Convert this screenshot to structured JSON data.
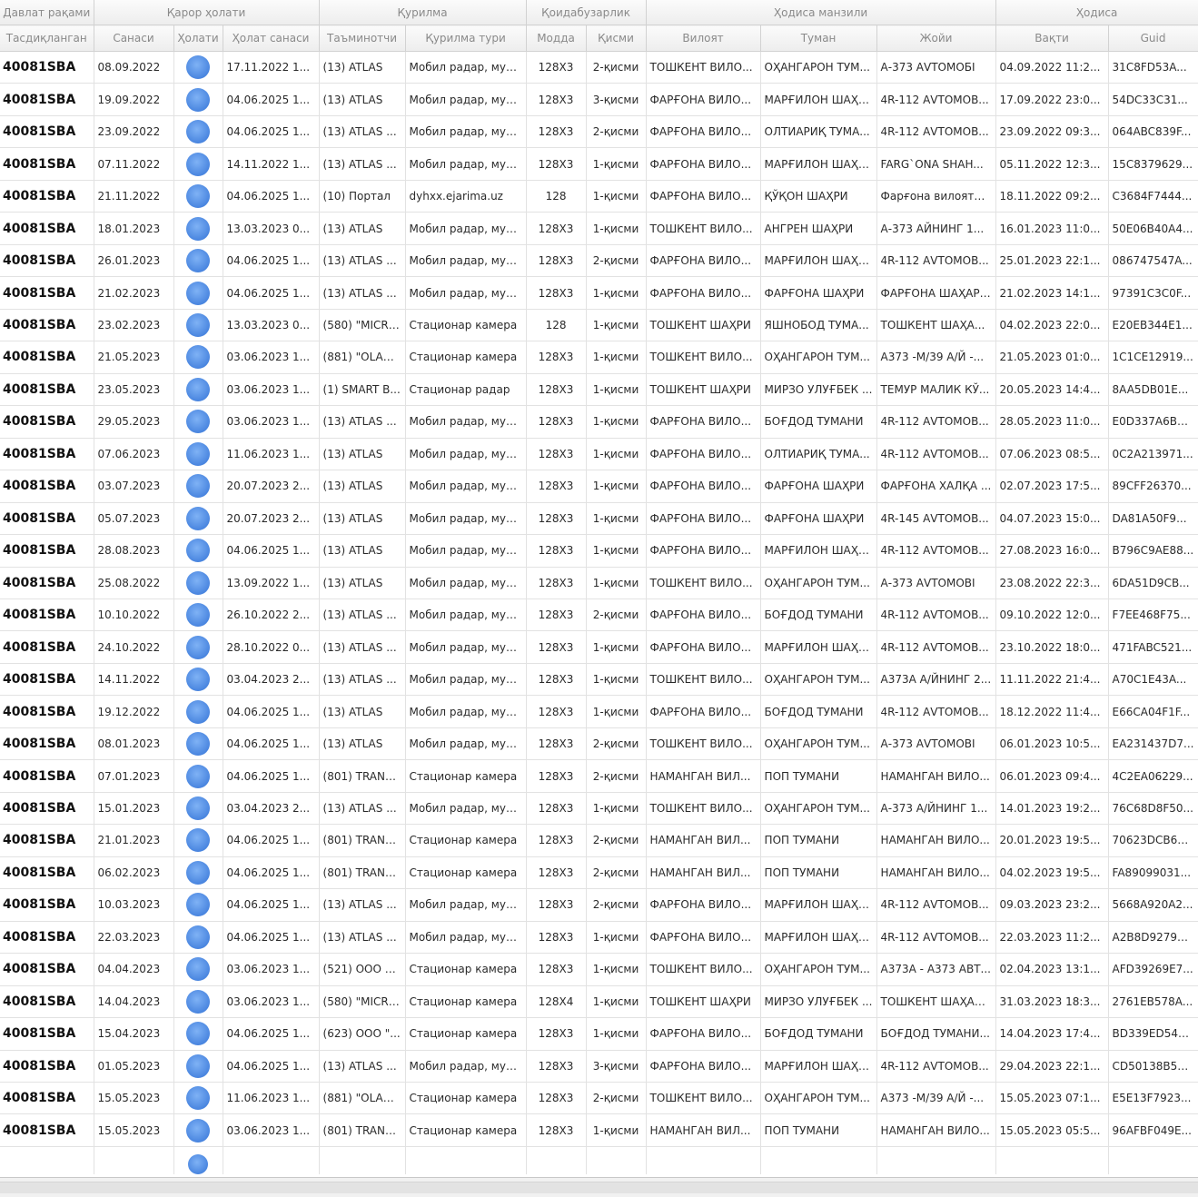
{
  "grid": {
    "band_headers": [
      {
        "label": "Давлат рақами",
        "span": 1
      },
      {
        "label": "Қарор ҳолати",
        "span": 3
      },
      {
        "label": "Қурилма",
        "span": 2
      },
      {
        "label": "Қоидабузарлик",
        "span": 2
      },
      {
        "label": "Ҳодиса манзили",
        "span": 3
      },
      {
        "label": "Ҳодиса",
        "span": 2
      }
    ],
    "columns": [
      "Тасдиқланган",
      "Санаси",
      "Ҳолати",
      "Ҳолат санаси",
      "Таъминотчи",
      "Қурилма тури",
      "Модда",
      "Қисми",
      "Вилоят",
      "Туман",
      "Жойи",
      "Вақти",
      "Guid"
    ],
    "status_icon": "blue-circle-status-icon",
    "accent_color": "#4a86e0",
    "rows": [
      [
        "40081SBA",
        "08.09.2022",
        "",
        "17.11.2022 1...",
        "(13) ATLAS",
        "Мобил радар, мув...",
        "128X3",
        "2-қисми",
        "ТОШКЕНТ ВИЛО...",
        "ОҲАНГАРОН ТУМ...",
        "А-373 АVТОМОБI",
        "04.09.2022 11:2...",
        "31C8FD53A..."
      ],
      [
        "40081SBA",
        "19.09.2022",
        "",
        "04.06.2025 1...",
        "(13) ATLAS",
        "Мобил радар, мув...",
        "128X3",
        "3-қисми",
        "ФАРҒОНА ВИЛО...",
        "МАРҒИЛОН ШАҲРИ",
        "4R-112 АVТОМОВ...",
        "17.09.2022 23:0...",
        "54DC33C31..."
      ],
      [
        "40081SBA",
        "23.09.2022",
        "",
        "04.06.2025 1...",
        "(13) ATLAS ...",
        "Мобил радар, мув...",
        "128X3",
        "2-қисми",
        "ФАРҒОНА ВИЛО...",
        "ОЛТИАРИҚ ТУМА...",
        "4R-112 АVТОМОВ...",
        "23.09.2022 09:3...",
        "064ABC839F..."
      ],
      [
        "40081SBA",
        "07.11.2022",
        "",
        "14.11.2022 1...",
        "(13) ATLAS ...",
        "Мобил радар, мув...",
        "128X3",
        "1-қисми",
        "ФАРҒОНА ВИЛО...",
        "МАРҒИЛОН ШАҲРИ",
        "FARG`ONA SHAH...",
        "05.11.2022 12:3...",
        "15C8379629..."
      ],
      [
        "40081SBA",
        "21.11.2022",
        "",
        "04.06.2025 1...",
        "(10) Портал",
        "dyhxx.ejarima.uz",
        "128",
        "1-қисми",
        "ФАРҒОНА ВИЛО...",
        "ҚЎҚОН ШАҲРИ",
        "Фарғона вилояти ...",
        "18.11.2022 09:2...",
        "C3684F7444..."
      ],
      [
        "40081SBA",
        "18.01.2023",
        "",
        "13.03.2023 0...",
        "(13) ATLAS",
        "Мобил радар, мув...",
        "128X3",
        "1-қисми",
        "ТОШКЕНТ ВИЛО...",
        "АНГРЕН ШАҲРИ",
        "А-373 АЙНИНГ 1...",
        "16.01.2023 11:0...",
        "50E06B40A4..."
      ],
      [
        "40081SBA",
        "26.01.2023",
        "",
        "04.06.2025 1...",
        "(13) ATLAS ...",
        "Мобил радар, мув...",
        "128X3",
        "2-қисми",
        "ФАРҒОНА ВИЛО...",
        "МАРҒИЛОН ШАҲРИ",
        "4R-112 АVТОМОВ...",
        "25.01.2023 22:1...",
        "086747547A..."
      ],
      [
        "40081SBA",
        "21.02.2023",
        "",
        "04.06.2025 1...",
        "(13) ATLAS ...",
        "Мобил радар, мув...",
        "128X3",
        "1-қисми",
        "ФАРҒОНА ВИЛО...",
        "ФАРҒОНА ШАҲРИ",
        "ФАРҒОНА ШАҲАР ...",
        "21.02.2023 14:1...",
        "97391C3C0F..."
      ],
      [
        "40081SBA",
        "23.02.2023",
        "",
        "13.03.2023 0...",
        "(580) \"MICR ...",
        "Стационар камера",
        "128",
        "1-қисми",
        "ТОШКЕНТ ШАҲРИ",
        "ЯШНОБОД ТУМА...",
        "ТОШКЕНТ ШАҲА...",
        "04.02.2023 22:0...",
        "E20EB344E1..."
      ],
      [
        "40081SBA",
        "21.05.2023",
        "",
        "03.06.2023 1...",
        "(881) \"OLAN ...",
        "Стационар камера",
        "128X3",
        "1-қисми",
        "ТОШКЕНТ ВИЛО...",
        "ОҲАНГАРОН ТУМ...",
        "А373 -М/39 А/Й -...",
        "21.05.2023 01:0...",
        "1C1CE12919..."
      ],
      [
        "40081SBA",
        "23.05.2023",
        "",
        "03.06.2023 1...",
        "(1) SMART B...",
        "Стационар радар",
        "128X3",
        "1-қисми",
        "ТОШКЕНТ ШАҲРИ",
        "МИРЗО УЛУҒБЕК ...",
        "ТЕМУР МАЛИК КЎ...",
        "20.05.2023 14:4...",
        "8AA5DB01E..."
      ],
      [
        "40081SBA",
        "29.05.2023",
        "",
        "03.06.2023 1...",
        "(13) ATLAS ...",
        "Мобил радар, мув...",
        "128X3",
        "1-қисми",
        "ФАРҒОНА ВИЛО...",
        "БОҒДОД ТУМАНИ",
        "4R-112 АVТОМОВ...",
        "28.05.2023 11:0...",
        "E0D337A6BE..."
      ],
      [
        "40081SBA",
        "07.06.2023",
        "",
        "11.06.2023 1...",
        "(13) ATLAS",
        "Мобил радар, мув...",
        "128X3",
        "1-қисми",
        "ФАРҒОНА ВИЛО...",
        "ОЛТИАРИҚ ТУМА...",
        "4R-112 АVТОМОВ...",
        "07.06.2023 08:5...",
        "0C2A213971..."
      ],
      [
        "40081SBA",
        "03.07.2023",
        "",
        "20.07.2023 2...",
        "(13) ATLAS",
        "Мобил радар, мув...",
        "128X3",
        "1-қисми",
        "ФАРҒОНА ВИЛО...",
        "ФАРҒОНА ШАҲРИ",
        "ФАРҒОНА ХАЛҚА ...",
        "02.07.2023 17:5...",
        "89CFF26370..."
      ],
      [
        "40081SBA",
        "05.07.2023",
        "",
        "20.07.2023 2...",
        "(13) ATLAS",
        "Мобил радар, мув...",
        "128X3",
        "1-қисми",
        "ФАРҒОНА ВИЛО...",
        "ФАРҒОНА ШАҲРИ",
        "4R-145 АVТОМОВ...",
        "04.07.2023 15:0...",
        "DA81A50F9..."
      ],
      [
        "40081SBA",
        "28.08.2023",
        "",
        "04.06.2025 1...",
        "(13) ATLAS",
        "Мобил радар, мув...",
        "128X3",
        "1-қисми",
        "ФАРҒОНА ВИЛО...",
        "МАРҒИЛОН ШАҲРИ",
        "4R-112 АVТОМОВ...",
        "27.08.2023 16:0...",
        "B796C9AE88..."
      ],
      [
        "40081SBA",
        "25.08.2022",
        "",
        "13.09.2022 1...",
        "(13) ATLAS",
        "Мобил радар, мув...",
        "128X3",
        "1-қисми",
        "ТОШКЕНТ ВИЛО...",
        "ОҲАНГАРОН ТУМ...",
        "А-373 АVТОМОВI",
        "23.08.2022 22:3...",
        "6DA51D9CB..."
      ],
      [
        "40081SBA",
        "10.10.2022",
        "",
        "26.10.2022 2...",
        "(13) ATLAS ...",
        "Мобил радар, мув...",
        "128X3",
        "2-қисми",
        "ФАРҒОНА ВИЛО...",
        "БОҒДОД ТУМАНИ",
        "4R-112 АVТОМОВ...",
        "09.10.2022 12:0...",
        "F7EE468F75..."
      ],
      [
        "40081SBA",
        "24.10.2022",
        "",
        "28.10.2022 0...",
        "(13) ATLAS ...",
        "Мобил радар, мув...",
        "128X3",
        "1-қисми",
        "ФАРҒОНА ВИЛО...",
        "МАРҒИЛОН ШАҲРИ",
        "4R-112 АVТОМОВ...",
        "23.10.2022 18:0...",
        "471FABC521..."
      ],
      [
        "40081SBA",
        "14.11.2022",
        "",
        "03.04.2023 2...",
        "(13) ATLAS ...",
        "Мобил радар, мув...",
        "128X3",
        "1-қисми",
        "ТОШКЕНТ ВИЛО...",
        "ОҲАНГАРОН ТУМ...",
        "А373А А/ЙНИНГ 2...",
        "11.11.2022 21:4...",
        "A70C1E43A..."
      ],
      [
        "40081SBA",
        "19.12.2022",
        "",
        "04.06.2025 1...",
        "(13) ATLAS",
        "Мобил радар, мув...",
        "128X3",
        "1-қисми",
        "ФАРҒОНА ВИЛО...",
        "БОҒДОД ТУМАНИ",
        "4R-112 АVТОМОВ...",
        "18.12.2022 11:4...",
        "E66CA04F1F..."
      ],
      [
        "40081SBA",
        "08.01.2023",
        "",
        "04.06.2025 1...",
        "(13) ATLAS",
        "Мобил радар, мув...",
        "128X3",
        "2-қисми",
        "ТОШКЕНТ ВИЛО...",
        "ОҲАНГАРОН ТУМ...",
        "А-373 АVТОМОВI",
        "06.01.2023 10:5...",
        "EA231437D7..."
      ],
      [
        "40081SBA",
        "07.01.2023",
        "",
        "04.06.2025 1...",
        "(801) TRANS...",
        "Стационар камера",
        "128X3",
        "2-қисми",
        "НАМАНГАН ВИЛ...",
        "ПОП ТУМАНИ",
        "НАМАНГАН ВИЛО...",
        "06.01.2023 09:4...",
        "4C2EA06229..."
      ],
      [
        "40081SBA",
        "15.01.2023",
        "",
        "03.04.2023 2...",
        "(13) ATLAS ...",
        "Мобил радар, мув...",
        "128X3",
        "1-қисми",
        "ТОШКЕНТ ВИЛО...",
        "ОҲАНГАРОН ТУМ...",
        "А-373 А/ЙНИНГ 1...",
        "14.01.2023 19:2...",
        "76C68D8F50..."
      ],
      [
        "40081SBA",
        "21.01.2023",
        "",
        "04.06.2025 1...",
        "(801) TRANS...",
        "Стационар камера",
        "128X3",
        "2-қисми",
        "НАМАНГАН ВИЛ...",
        "ПОП ТУМАНИ",
        "НАМАНГАН ВИЛО...",
        "20.01.2023 19:5...",
        "70623DCB62..."
      ],
      [
        "40081SBA",
        "06.02.2023",
        "",
        "04.06.2025 1...",
        "(801) TRANS...",
        "Стационар камера",
        "128X3",
        "2-қисми",
        "НАМАНГАН ВИЛ...",
        "ПОП ТУМАНИ",
        "НАМАНГАН ВИЛО...",
        "04.02.2023 19:5...",
        "FA89099031..."
      ],
      [
        "40081SBA",
        "10.03.2023",
        "",
        "04.06.2025 1...",
        "(13) ATLAS ...",
        "Мобил радар, мув...",
        "128X3",
        "2-қисми",
        "ФАРҒОНА ВИЛО...",
        "МАРҒИЛОН ШАҲРИ",
        "4R-112 АVТОМОВ...",
        "09.03.2023 23:2...",
        "5668A920A2..."
      ],
      [
        "40081SBA",
        "22.03.2023",
        "",
        "04.06.2025 1...",
        "(13) ATLAS ...",
        "Мобил радар, мув...",
        "128X3",
        "1-қисми",
        "ФАРҒОНА ВИЛО...",
        "МАРҒИЛОН ШАҲРИ",
        "4R-112 АVТОМОВ...",
        "22.03.2023 11:2...",
        "A2B8D92798..."
      ],
      [
        "40081SBA",
        "04.04.2023",
        "",
        "03.06.2023 1...",
        "(521) ООО «...",
        "Стационар камера",
        "128X3",
        "1-қисми",
        "ТОШКЕНТ ВИЛО...",
        "ОҲАНГАРОН ТУМ...",
        "А373А - А373 АВТ...",
        "02.04.2023 13:1...",
        "AFD39269E7..."
      ],
      [
        "40081SBA",
        "14.04.2023",
        "",
        "03.06.2023 1...",
        "(580) \"MICR ...",
        "Стационар камера",
        "128X4",
        "1-қисми",
        "ТОШКЕНТ ШАҲРИ",
        "МИРЗО УЛУҒБЕК ...",
        "ТОШКЕНТ ШАҲАР ...",
        "31.03.2023 18:3...",
        "2761EB578A..."
      ],
      [
        "40081SBA",
        "15.04.2023",
        "",
        "04.06.2025 1...",
        "(623) ООО \"...",
        "Стационар камера",
        "128X3",
        "1-қисми",
        "ФАРҒОНА ВИЛО...",
        "БОҒДОД ТУМАНИ",
        "БОҒДОД ТУМАНИ...",
        "14.04.2023 17:4...",
        "BD339ED54B..."
      ],
      [
        "40081SBA",
        "01.05.2023",
        "",
        "04.06.2025 1...",
        "(13) ATLAS ...",
        "Мобил радар, мув...",
        "128X3",
        "3-қисми",
        "ФАРҒОНА ВИЛО...",
        "МАРҒИЛОН ШАҲРИ",
        "4R-112 АVТОМОВ...",
        "29.04.2023 22:1...",
        "CD50138B5E..."
      ],
      [
        "40081SBA",
        "15.05.2023",
        "",
        "11.06.2023 1...",
        "(881) \"OLAN ...",
        "Стационар камера",
        "128X3",
        "2-қисми",
        "ТОШКЕНТ ВИЛО...",
        "ОҲАНГАРОН ТУМ...",
        "А373 -М/39 А/Й -...",
        "15.05.2023 07:1...",
        "E5E13F7923..."
      ],
      [
        "40081SBA",
        "15.05.2023",
        "",
        "03.06.2023 1...",
        "(801) TRANS...",
        "Стационар камера",
        "128X3",
        "1-қисми",
        "НАМАНГАН ВИЛ...",
        "ПОП ТУМАНИ",
        "НАМАНГАН ВИЛО...",
        "15.05.2023 05:5...",
        "96AFBF049E..."
      ]
    ]
  }
}
